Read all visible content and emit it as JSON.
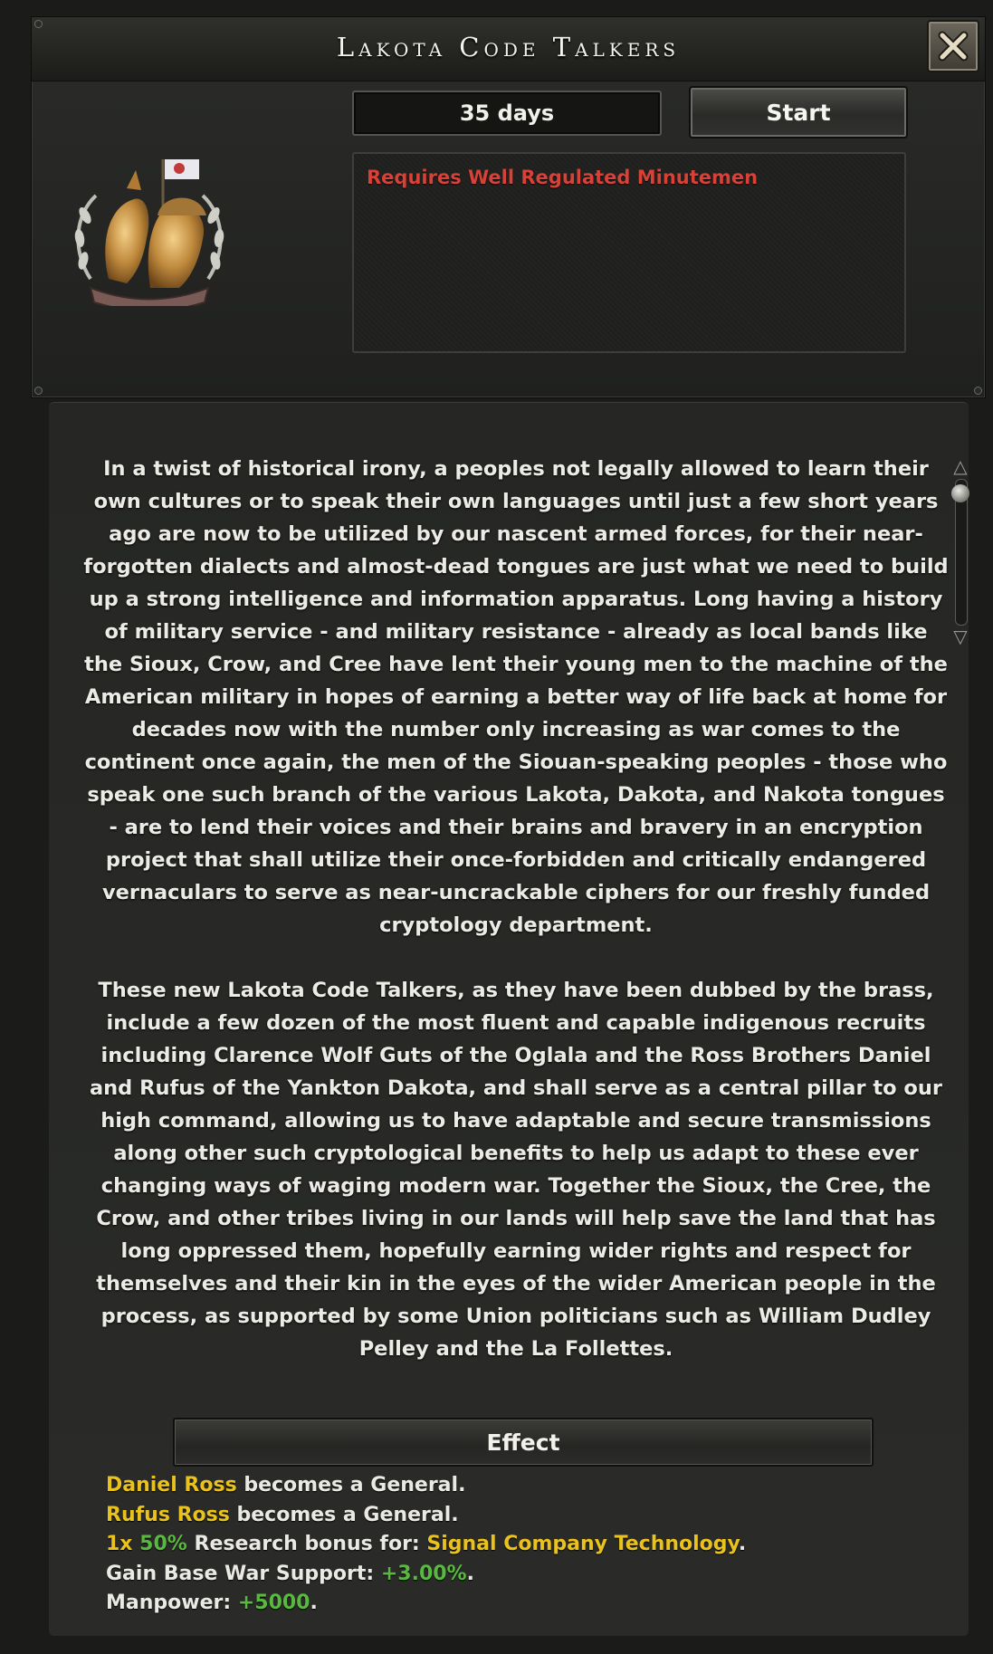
{
  "window": {
    "title": "Lakota Code Talkers",
    "duration": "35 days",
    "start_label": "Start",
    "requirement": "Requires Well Regulated Minutemen"
  },
  "description": {
    "paragraph1": "In a twist of historical irony, a peoples not legally allowed to learn their own cultures or to speak their own languages until just a few short years ago are now to be utilized by our nascent armed forces, for their near-forgotten dialects and almost-dead tongues are just what we need to build up a strong intelligence and information apparatus. Long having a history of military service - and military resistance - already as local bands like the Sioux, Crow, and Cree have lent their young men to the machine of the American military in hopes of earning a better way of life back at home for decades now with the number only increasing as war comes to the continent once again, the men of the Siouan-speaking peoples - those who speak one such branch of the various Lakota, Dakota, and Nakota tongues - are to lend their voices and their brains and bravery in an encryption project that shall utilize their once-forbidden and critically endangered vernaculars to serve as near-uncrackable ciphers for our freshly funded cryptology department.",
    "paragraph2": "These new Lakota Code Talkers, as they have been dubbed by the brass, include a few dozen of the most fluent and capable indigenous recruits including Clarence Wolf Guts of the Oglala and the Ross Brothers Daniel and Rufus of the Yankton Dakota, and shall serve as a central pillar to our high command, allowing us to have adaptable and secure transmissions along other such cryptological benefits to help us adapt to these ever changing ways of waging modern war. Together the Sioux, the Cree, the Crow, and other tribes living in our lands will help save the land that has long oppressed them, hopefully earning wider rights and respect for themselves and their kin in the eyes of the wider American people in the process, as supported by some Union politicians such as William Dudley Pelley and the La Follettes."
  },
  "effect": {
    "header": "Effect",
    "lines": [
      {
        "name": "Daniel Ross",
        "text": " becomes a General."
      },
      {
        "name": "Rufus Ross",
        "text": " becomes a General."
      },
      {
        "prefix": "1x ",
        "percent": "50%",
        "middle": " Research bonus for: ",
        "tech": "Signal Company Technology",
        "suffix": "."
      },
      {
        "label": "Gain Base War Support: ",
        "value": "+3.00%",
        "suffix": "."
      },
      {
        "label": "Manpower: ",
        "value": "+5000",
        "suffix": "."
      }
    ]
  },
  "colors": {
    "requirement": "#d74137",
    "highlight_yellow": "#e9c21d",
    "highlight_green": "#58b83f"
  },
  "icons": [
    "close-icon",
    "code-talkers-emblem",
    "scroll-up-icon",
    "scroll-down-icon"
  ]
}
